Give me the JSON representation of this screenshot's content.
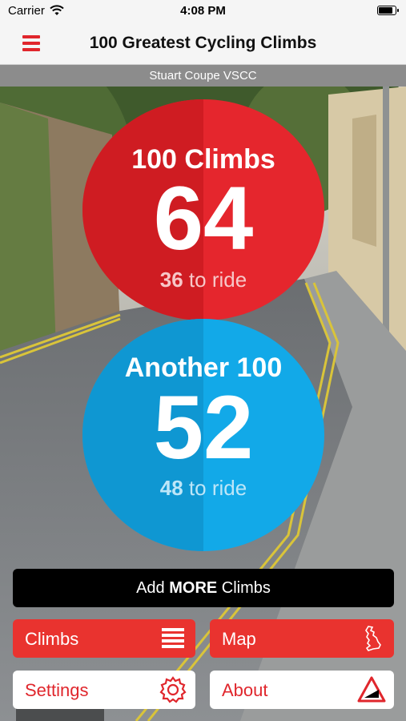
{
  "status_bar": {
    "carrier": "Carrier",
    "time": "4:08 PM"
  },
  "nav": {
    "title": "100 Greatest Cycling Climbs",
    "menu_icon": "hamburger-icon"
  },
  "user": {
    "name": "Stuart Coupe VSCC"
  },
  "counters": [
    {
      "label": "100 Climbs",
      "count": "64",
      "to_ride": "36",
      "to_ride_suffix": " to ride",
      "color": "#e5262d"
    },
    {
      "label": "Another 100",
      "count": "52",
      "to_ride": "48",
      "to_ride_suffix": " to ride",
      "color": "#12a9e8"
    }
  ],
  "add_more": {
    "prefix": "Add ",
    "emphasis": "MORE",
    "suffix": " Climbs"
  },
  "tiles": [
    {
      "label": "Climbs",
      "icon": "list-icon"
    },
    {
      "label": "Map",
      "icon": "uk-map-icon"
    },
    {
      "label": "Settings",
      "icon": "gear-icon"
    },
    {
      "label": "About",
      "icon": "gradient-sign-icon"
    }
  ],
  "colors": {
    "accent": "#e0262c",
    "blue": "#12a9e8",
    "black_button": "#000000"
  }
}
